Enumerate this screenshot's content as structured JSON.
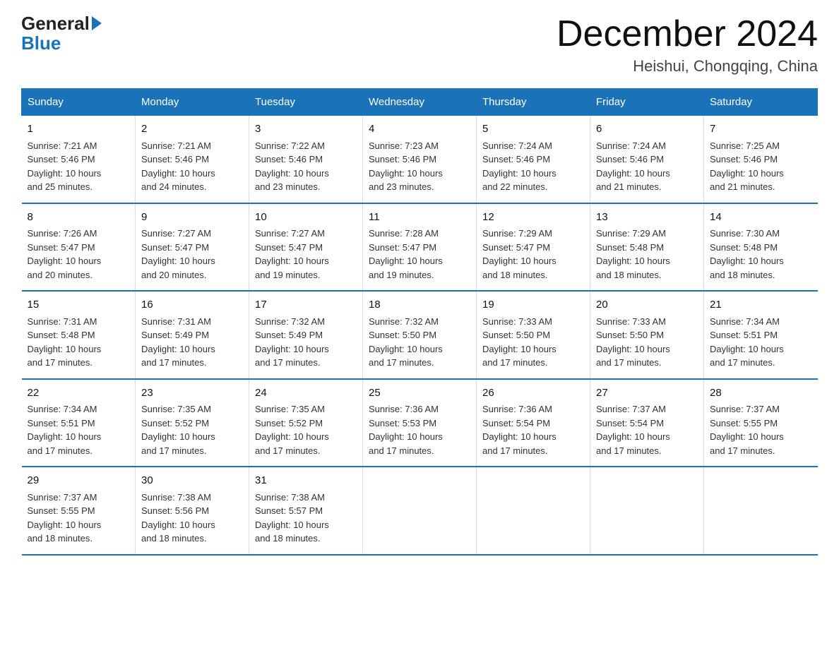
{
  "logo": {
    "general": "General",
    "blue": "Blue"
  },
  "title": "December 2024",
  "subtitle": "Heishui, Chongqing, China",
  "headers": [
    "Sunday",
    "Monday",
    "Tuesday",
    "Wednesday",
    "Thursday",
    "Friday",
    "Saturday"
  ],
  "weeks": [
    [
      {
        "day": "1",
        "sunrise": "7:21 AM",
        "sunset": "5:46 PM",
        "daylight": "10 hours and 25 minutes."
      },
      {
        "day": "2",
        "sunrise": "7:21 AM",
        "sunset": "5:46 PM",
        "daylight": "10 hours and 24 minutes."
      },
      {
        "day": "3",
        "sunrise": "7:22 AM",
        "sunset": "5:46 PM",
        "daylight": "10 hours and 23 minutes."
      },
      {
        "day": "4",
        "sunrise": "7:23 AM",
        "sunset": "5:46 PM",
        "daylight": "10 hours and 23 minutes."
      },
      {
        "day": "5",
        "sunrise": "7:24 AM",
        "sunset": "5:46 PM",
        "daylight": "10 hours and 22 minutes."
      },
      {
        "day": "6",
        "sunrise": "7:24 AM",
        "sunset": "5:46 PM",
        "daylight": "10 hours and 21 minutes."
      },
      {
        "day": "7",
        "sunrise": "7:25 AM",
        "sunset": "5:46 PM",
        "daylight": "10 hours and 21 minutes."
      }
    ],
    [
      {
        "day": "8",
        "sunrise": "7:26 AM",
        "sunset": "5:47 PM",
        "daylight": "10 hours and 20 minutes."
      },
      {
        "day": "9",
        "sunrise": "7:27 AM",
        "sunset": "5:47 PM",
        "daylight": "10 hours and 20 minutes."
      },
      {
        "day": "10",
        "sunrise": "7:27 AM",
        "sunset": "5:47 PM",
        "daylight": "10 hours and 19 minutes."
      },
      {
        "day": "11",
        "sunrise": "7:28 AM",
        "sunset": "5:47 PM",
        "daylight": "10 hours and 19 minutes."
      },
      {
        "day": "12",
        "sunrise": "7:29 AM",
        "sunset": "5:47 PM",
        "daylight": "10 hours and 18 minutes."
      },
      {
        "day": "13",
        "sunrise": "7:29 AM",
        "sunset": "5:48 PM",
        "daylight": "10 hours and 18 minutes."
      },
      {
        "day": "14",
        "sunrise": "7:30 AM",
        "sunset": "5:48 PM",
        "daylight": "10 hours and 18 minutes."
      }
    ],
    [
      {
        "day": "15",
        "sunrise": "7:31 AM",
        "sunset": "5:48 PM",
        "daylight": "10 hours and 17 minutes."
      },
      {
        "day": "16",
        "sunrise": "7:31 AM",
        "sunset": "5:49 PM",
        "daylight": "10 hours and 17 minutes."
      },
      {
        "day": "17",
        "sunrise": "7:32 AM",
        "sunset": "5:49 PM",
        "daylight": "10 hours and 17 minutes."
      },
      {
        "day": "18",
        "sunrise": "7:32 AM",
        "sunset": "5:50 PM",
        "daylight": "10 hours and 17 minutes."
      },
      {
        "day": "19",
        "sunrise": "7:33 AM",
        "sunset": "5:50 PM",
        "daylight": "10 hours and 17 minutes."
      },
      {
        "day": "20",
        "sunrise": "7:33 AM",
        "sunset": "5:50 PM",
        "daylight": "10 hours and 17 minutes."
      },
      {
        "day": "21",
        "sunrise": "7:34 AM",
        "sunset": "5:51 PM",
        "daylight": "10 hours and 17 minutes."
      }
    ],
    [
      {
        "day": "22",
        "sunrise": "7:34 AM",
        "sunset": "5:51 PM",
        "daylight": "10 hours and 17 minutes."
      },
      {
        "day": "23",
        "sunrise": "7:35 AM",
        "sunset": "5:52 PM",
        "daylight": "10 hours and 17 minutes."
      },
      {
        "day": "24",
        "sunrise": "7:35 AM",
        "sunset": "5:52 PM",
        "daylight": "10 hours and 17 minutes."
      },
      {
        "day": "25",
        "sunrise": "7:36 AM",
        "sunset": "5:53 PM",
        "daylight": "10 hours and 17 minutes."
      },
      {
        "day": "26",
        "sunrise": "7:36 AM",
        "sunset": "5:54 PM",
        "daylight": "10 hours and 17 minutes."
      },
      {
        "day": "27",
        "sunrise": "7:37 AM",
        "sunset": "5:54 PM",
        "daylight": "10 hours and 17 minutes."
      },
      {
        "day": "28",
        "sunrise": "7:37 AM",
        "sunset": "5:55 PM",
        "daylight": "10 hours and 17 minutes."
      }
    ],
    [
      {
        "day": "29",
        "sunrise": "7:37 AM",
        "sunset": "5:55 PM",
        "daylight": "10 hours and 18 minutes."
      },
      {
        "day": "30",
        "sunrise": "7:38 AM",
        "sunset": "5:56 PM",
        "daylight": "10 hours and 18 minutes."
      },
      {
        "day": "31",
        "sunrise": "7:38 AM",
        "sunset": "5:57 PM",
        "daylight": "10 hours and 18 minutes."
      },
      null,
      null,
      null,
      null
    ]
  ],
  "labels": {
    "sunrise": "Sunrise:",
    "sunset": "Sunset:",
    "daylight": "Daylight:"
  }
}
